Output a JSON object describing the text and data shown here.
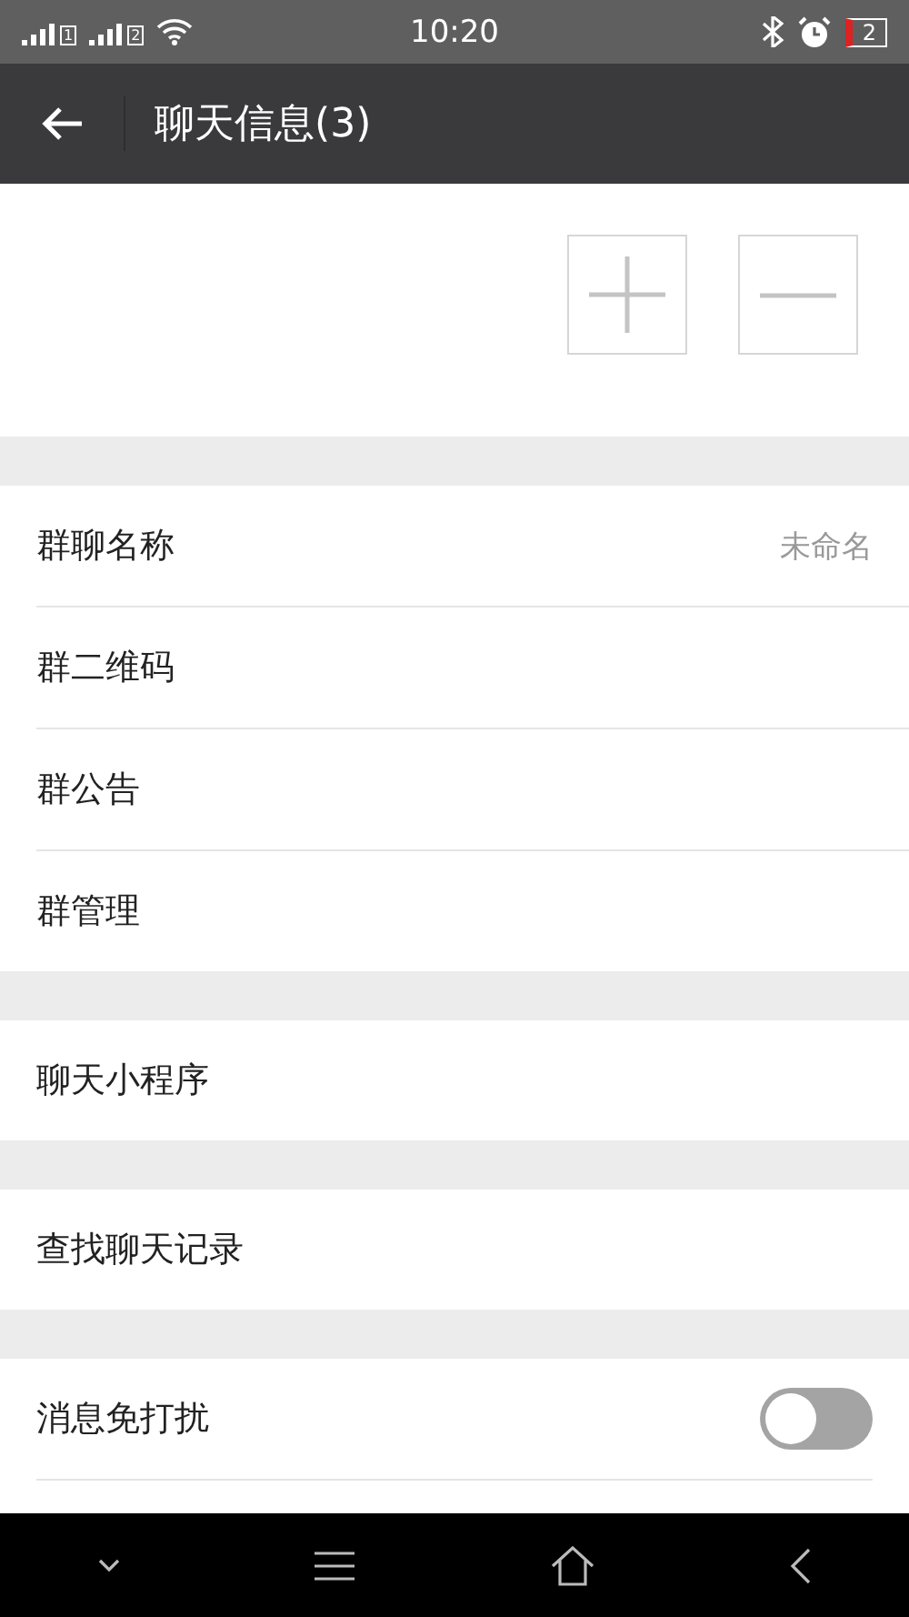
{
  "status_bar": {
    "sims": [
      "1",
      "2"
    ],
    "time": "10:20",
    "battery": "2"
  },
  "app_bar": {
    "title": "聊天信息(3)"
  },
  "member_actions": [
    {
      "kind": "add"
    },
    {
      "kind": "remove"
    }
  ],
  "sections": [
    {
      "items": [
        {
          "kind": "value",
          "label": "群聊名称",
          "value": "未命名"
        },
        {
          "kind": "plain",
          "label": "群二维码"
        },
        {
          "kind": "plain",
          "label": "群公告"
        },
        {
          "kind": "plain",
          "label": "群管理"
        }
      ]
    },
    {
      "items": [
        {
          "kind": "plain",
          "label": "聊天小程序"
        }
      ]
    },
    {
      "items": [
        {
          "kind": "plain",
          "label": "查找聊天记录"
        }
      ]
    },
    {
      "items": [
        {
          "kind": "toggle",
          "label": "消息免打扰",
          "on": false
        }
      ]
    }
  ]
}
